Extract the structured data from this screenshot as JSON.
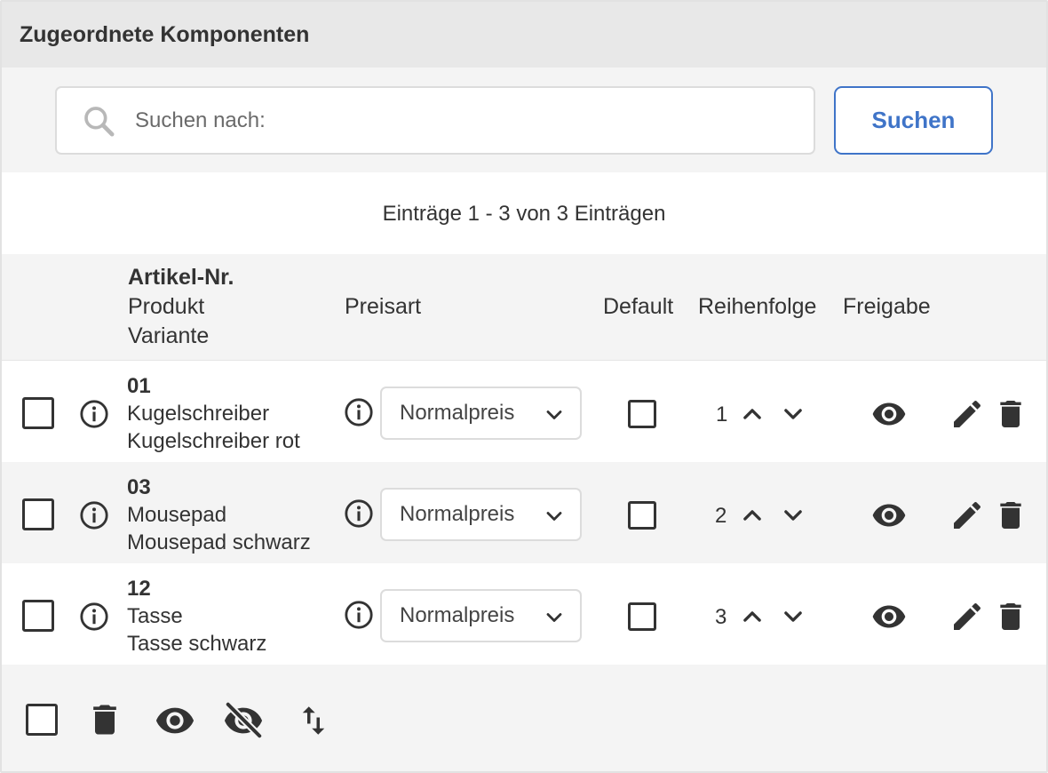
{
  "panel": {
    "title": "Zugeordnete Komponenten"
  },
  "search": {
    "placeholder": "Suchen nach:",
    "button_label": "Suchen"
  },
  "entries": {
    "summary": "Einträge 1 - 3 von 3 Einträgen"
  },
  "columns": {
    "article_number": "Artikel-Nr.",
    "product": "Produkt",
    "variant": "Variante",
    "price_type": "Preisart",
    "default": "Default",
    "order": "Reihenfolge",
    "release": "Freigabe"
  },
  "rows": [
    {
      "article_number": "01",
      "product": "Kugelschreiber",
      "variant": "Kugelschreiber rot",
      "price_type": "Normalpreis",
      "order": "1"
    },
    {
      "article_number": "03",
      "product": "Mousepad",
      "variant": "Mousepad schwarz",
      "price_type": "Normalpreis",
      "order": "2"
    },
    {
      "article_number": "12",
      "product": "Tasse",
      "variant": "Tasse schwarz",
      "price_type": "Normalpreis",
      "order": "3"
    }
  ],
  "footer_actions": [
    "select-all-checkbox",
    "bulk-delete-icon",
    "bulk-show-icon",
    "bulk-hide-icon",
    "sort-icon"
  ],
  "colors": {
    "accent": "#3f74c8",
    "icon": "#333333",
    "header_bg": "#e8e8e8",
    "panel_bg": "#f4f4f4"
  }
}
